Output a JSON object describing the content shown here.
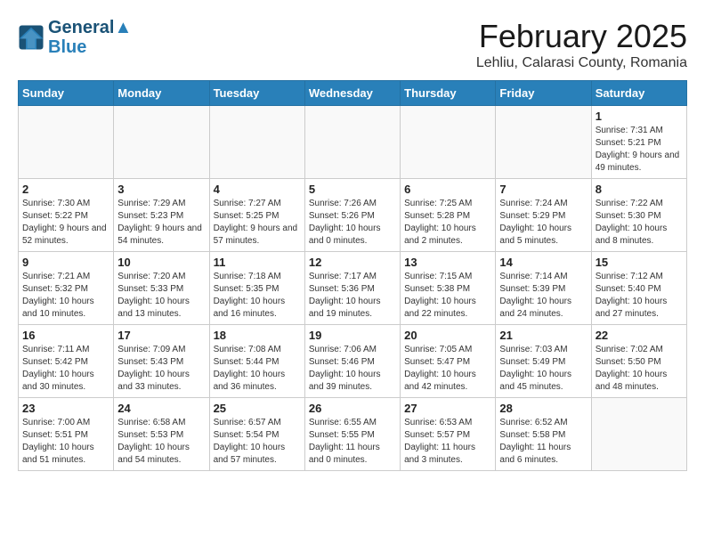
{
  "header": {
    "logo_line1": "General",
    "logo_line2": "Blue",
    "month": "February 2025",
    "location": "Lehliu, Calarasi County, Romania"
  },
  "weekdays": [
    "Sunday",
    "Monday",
    "Tuesday",
    "Wednesday",
    "Thursday",
    "Friday",
    "Saturday"
  ],
  "weeks": [
    [
      {
        "day": "",
        "detail": ""
      },
      {
        "day": "",
        "detail": ""
      },
      {
        "day": "",
        "detail": ""
      },
      {
        "day": "",
        "detail": ""
      },
      {
        "day": "",
        "detail": ""
      },
      {
        "day": "",
        "detail": ""
      },
      {
        "day": "1",
        "detail": "Sunrise: 7:31 AM\nSunset: 5:21 PM\nDaylight: 9 hours and 49 minutes."
      }
    ],
    [
      {
        "day": "2",
        "detail": "Sunrise: 7:30 AM\nSunset: 5:22 PM\nDaylight: 9 hours and 52 minutes."
      },
      {
        "day": "3",
        "detail": "Sunrise: 7:29 AM\nSunset: 5:23 PM\nDaylight: 9 hours and 54 minutes."
      },
      {
        "day": "4",
        "detail": "Sunrise: 7:27 AM\nSunset: 5:25 PM\nDaylight: 9 hours and 57 minutes."
      },
      {
        "day": "5",
        "detail": "Sunrise: 7:26 AM\nSunset: 5:26 PM\nDaylight: 10 hours and 0 minutes."
      },
      {
        "day": "6",
        "detail": "Sunrise: 7:25 AM\nSunset: 5:28 PM\nDaylight: 10 hours and 2 minutes."
      },
      {
        "day": "7",
        "detail": "Sunrise: 7:24 AM\nSunset: 5:29 PM\nDaylight: 10 hours and 5 minutes."
      },
      {
        "day": "8",
        "detail": "Sunrise: 7:22 AM\nSunset: 5:30 PM\nDaylight: 10 hours and 8 minutes."
      }
    ],
    [
      {
        "day": "9",
        "detail": "Sunrise: 7:21 AM\nSunset: 5:32 PM\nDaylight: 10 hours and 10 minutes."
      },
      {
        "day": "10",
        "detail": "Sunrise: 7:20 AM\nSunset: 5:33 PM\nDaylight: 10 hours and 13 minutes."
      },
      {
        "day": "11",
        "detail": "Sunrise: 7:18 AM\nSunset: 5:35 PM\nDaylight: 10 hours and 16 minutes."
      },
      {
        "day": "12",
        "detail": "Sunrise: 7:17 AM\nSunset: 5:36 PM\nDaylight: 10 hours and 19 minutes."
      },
      {
        "day": "13",
        "detail": "Sunrise: 7:15 AM\nSunset: 5:38 PM\nDaylight: 10 hours and 22 minutes."
      },
      {
        "day": "14",
        "detail": "Sunrise: 7:14 AM\nSunset: 5:39 PM\nDaylight: 10 hours and 24 minutes."
      },
      {
        "day": "15",
        "detail": "Sunrise: 7:12 AM\nSunset: 5:40 PM\nDaylight: 10 hours and 27 minutes."
      }
    ],
    [
      {
        "day": "16",
        "detail": "Sunrise: 7:11 AM\nSunset: 5:42 PM\nDaylight: 10 hours and 30 minutes."
      },
      {
        "day": "17",
        "detail": "Sunrise: 7:09 AM\nSunset: 5:43 PM\nDaylight: 10 hours and 33 minutes."
      },
      {
        "day": "18",
        "detail": "Sunrise: 7:08 AM\nSunset: 5:44 PM\nDaylight: 10 hours and 36 minutes."
      },
      {
        "day": "19",
        "detail": "Sunrise: 7:06 AM\nSunset: 5:46 PM\nDaylight: 10 hours and 39 minutes."
      },
      {
        "day": "20",
        "detail": "Sunrise: 7:05 AM\nSunset: 5:47 PM\nDaylight: 10 hours and 42 minutes."
      },
      {
        "day": "21",
        "detail": "Sunrise: 7:03 AM\nSunset: 5:49 PM\nDaylight: 10 hours and 45 minutes."
      },
      {
        "day": "22",
        "detail": "Sunrise: 7:02 AM\nSunset: 5:50 PM\nDaylight: 10 hours and 48 minutes."
      }
    ],
    [
      {
        "day": "23",
        "detail": "Sunrise: 7:00 AM\nSunset: 5:51 PM\nDaylight: 10 hours and 51 minutes."
      },
      {
        "day": "24",
        "detail": "Sunrise: 6:58 AM\nSunset: 5:53 PM\nDaylight: 10 hours and 54 minutes."
      },
      {
        "day": "25",
        "detail": "Sunrise: 6:57 AM\nSunset: 5:54 PM\nDaylight: 10 hours and 57 minutes."
      },
      {
        "day": "26",
        "detail": "Sunrise: 6:55 AM\nSunset: 5:55 PM\nDaylight: 11 hours and 0 minutes."
      },
      {
        "day": "27",
        "detail": "Sunrise: 6:53 AM\nSunset: 5:57 PM\nDaylight: 11 hours and 3 minutes."
      },
      {
        "day": "28",
        "detail": "Sunrise: 6:52 AM\nSunset: 5:58 PM\nDaylight: 11 hours and 6 minutes."
      },
      {
        "day": "",
        "detail": ""
      }
    ]
  ]
}
